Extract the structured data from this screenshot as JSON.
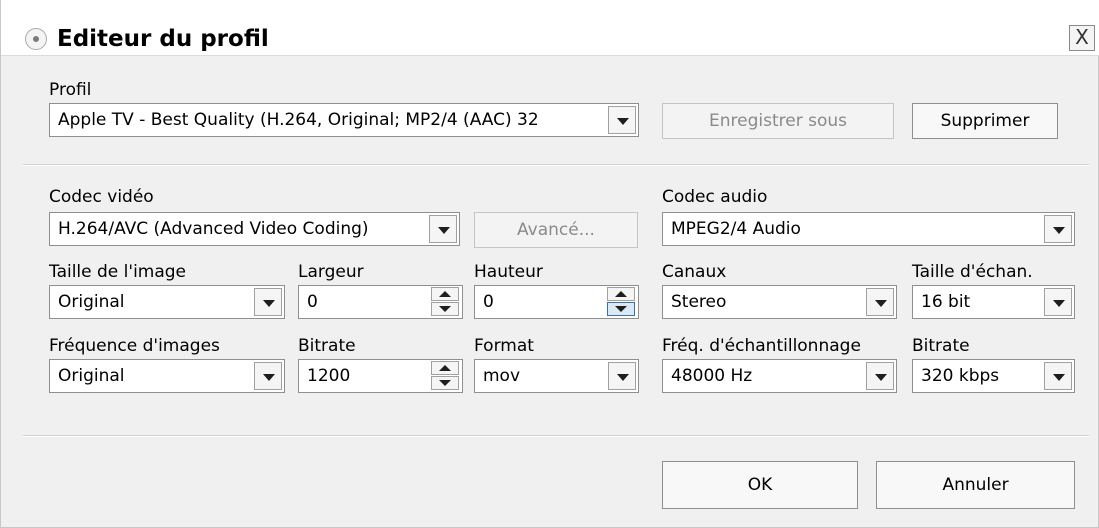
{
  "window": {
    "title": "Editeur du profil",
    "close_label": "X"
  },
  "profile": {
    "label": "Profil",
    "value": "Apple TV - Best Quality (H.264, Original; MP2/4 (AAC) 32",
    "save_as_label": "Enregistrer sous",
    "delete_label": "Supprimer"
  },
  "video": {
    "codec_label": "Codec vidéo",
    "codec_value": "H.264/AVC (Advanced Video Coding)",
    "advanced_label": "Avancé...",
    "size_label": "Taille de l'image",
    "size_value": "Original",
    "width_label": "Largeur",
    "width_value": "0",
    "height_label": "Hauteur",
    "height_value": "0",
    "fps_label": "Fréquence d'images",
    "fps_value": "Original",
    "bitrate_label": "Bitrate",
    "bitrate_value": "1200",
    "format_label": "Format",
    "format_value": "mov"
  },
  "audio": {
    "codec_label": "Codec audio",
    "codec_value": "MPEG2/4 Audio",
    "channels_label": "Canaux",
    "channels_value": "Stereo",
    "sample_size_label": "Taille d'échan.",
    "sample_size_value": "16 bit",
    "sample_rate_label": "Fréq. d'échantillonnage",
    "sample_rate_value": "48000 Hz",
    "bitrate_label": "Bitrate",
    "bitrate_value": "320 kbps"
  },
  "footer": {
    "ok_label": "OK",
    "cancel_label": "Annuler"
  },
  "icons": {
    "title": "bullet-icon",
    "close": "close-icon",
    "dropdown": "chevron-down-icon",
    "spin_up": "arrow-up-icon",
    "spin_down": "arrow-down-icon"
  },
  "colors": {
    "dialog_bg": "#f0f0f0",
    "spin_hover_border": "#3d6fa8",
    "disabled_text": "#8a8a8a"
  }
}
